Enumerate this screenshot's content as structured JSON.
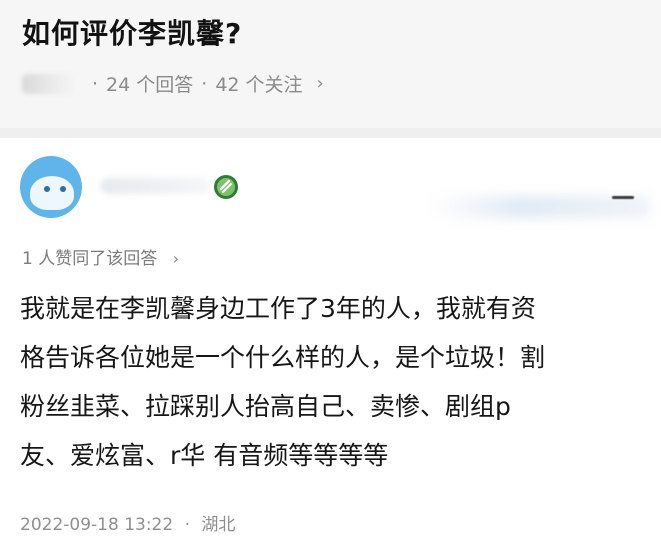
{
  "question": {
    "title": "如何评价李凯馨?",
    "answer_count": "24 个回答",
    "follower_count": "42 个关注",
    "separator": "·",
    "more_chevron": "›"
  },
  "answer": {
    "avatar_icon": "avatar-icon",
    "badge_icon": "verified-badge-icon",
    "more_icon": "more-options-icon",
    "upvote_summary": "1 人赞同了该回答",
    "upvote_chevron": "›",
    "body_lines": [
      "我就是在李凯馨身边工作了3年的人，我就有资",
      "格告诉各位她是一个什么样的人，是个垃圾！割",
      "粉丝韭菜、拉踩别人抬高自己、卖惨、剧组p",
      "友、爱炫富、r华 有音频等等等等"
    ],
    "date": "2022-09-18 13:22",
    "separator": "·",
    "location": "湖北"
  },
  "colors": {
    "header_bg": "#f6f6f6",
    "meta_text": "#8a8a8a",
    "avatar_blue": "#5fb4ea",
    "badge_green": "#3f9d3f"
  }
}
